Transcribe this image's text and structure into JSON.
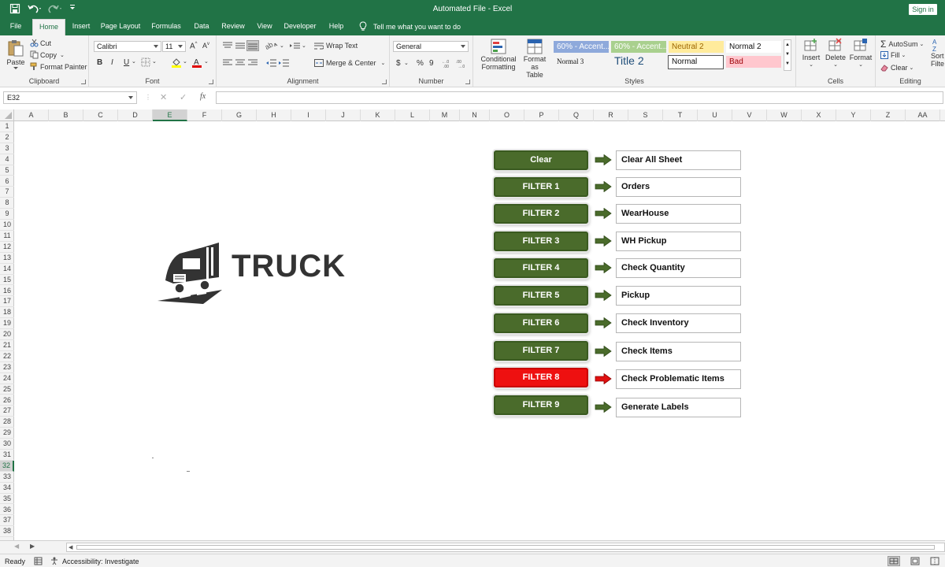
{
  "window": {
    "title": "Automated File  -  Excel",
    "sign_in": "Sign in"
  },
  "tabs": [
    {
      "label": "File"
    },
    {
      "label": "Home"
    },
    {
      "label": "Insert"
    },
    {
      "label": "Page Layout"
    },
    {
      "label": "Formulas"
    },
    {
      "label": "Data"
    },
    {
      "label": "Review"
    },
    {
      "label": "View"
    },
    {
      "label": "Developer"
    },
    {
      "label": "Help"
    }
  ],
  "tell_me": "Tell me what you want to do",
  "ribbon": {
    "clipboard": {
      "paste": "Paste",
      "cut": "Cut",
      "copy": "Copy",
      "format_painter": "Format Painter",
      "label": "Clipboard"
    },
    "font": {
      "name": "Calibri",
      "size": "11",
      "bold": "B",
      "italic": "I",
      "underline": "U",
      "label": "Font"
    },
    "alignment": {
      "wrap_text": "Wrap Text",
      "merge_center": "Merge & Center",
      "label": "Alignment"
    },
    "number": {
      "format": "General",
      "currency": "$",
      "percent": "%",
      "comma": "9",
      "label": "Number"
    },
    "styles": {
      "conditional_1": "Conditional",
      "conditional_2": "Formatting",
      "format_as_1": "Format as",
      "format_as_2": "Table",
      "cells": [
        {
          "label": "60% - Accent...",
          "color": "#8ea9db"
        },
        {
          "label": "60% - Accent...",
          "color": "#a9d08e"
        },
        {
          "label": "Neutral 2",
          "color": "#ffeb9c"
        },
        {
          "label": "Normal 2",
          "color": "#ffffff"
        },
        {
          "label": "Normal 3",
          "color": "#ffffff"
        },
        {
          "label": "Title 2",
          "color": "#ffffff"
        },
        {
          "label": "Normal",
          "color": "#ffffff"
        },
        {
          "label": "Bad",
          "color": "#ffc7ce"
        }
      ],
      "label": "Styles"
    },
    "cells": {
      "insert": "Insert",
      "delete": "Delete",
      "format": "Format",
      "label": "Cells"
    },
    "editing": {
      "autosum": "AutoSum",
      "fill": "Fill",
      "clear": "Clear",
      "sort_1": "Sort",
      "sort_2": "Filte",
      "label": "Editing"
    }
  },
  "formula_bar": {
    "name_box": "E32",
    "fx": "fx",
    "value": ""
  },
  "columns": [
    "A",
    "B",
    "C",
    "D",
    "E",
    "F",
    "G",
    "H",
    "I",
    "J",
    "K",
    "L",
    "M",
    "N",
    "O",
    "P",
    "Q",
    "R",
    "S",
    "T",
    "U",
    "V",
    "W",
    "X",
    "Y",
    "Z",
    "AA"
  ],
  "selected_column": "E",
  "rows": [
    "1",
    "2",
    "3",
    "4",
    "5",
    "6",
    "7",
    "8",
    "9",
    "10",
    "11",
    "12",
    "13",
    "14",
    "15",
    "16",
    "17",
    "18",
    "19",
    "20",
    "21",
    "22",
    "23",
    "24",
    "25",
    "26",
    "27",
    "28",
    "29",
    "30",
    "31",
    "32",
    "33",
    "34",
    "35",
    "36",
    "37",
    "38"
  ],
  "selected_row": "32",
  "logo": {
    "text": "TRUCK"
  },
  "filters": [
    {
      "button": "Clear",
      "description": "Clear All Sheet",
      "color": "#4a6b2b"
    },
    {
      "button": "FILTER 1",
      "description": "Orders",
      "color": "#4a6b2b"
    },
    {
      "button": "FILTER 2",
      "description": "WearHouse",
      "color": "#4a6b2b"
    },
    {
      "button": "FILTER 3",
      "description": "WH Pickup",
      "color": "#4a6b2b"
    },
    {
      "button": "FILTER 4",
      "description": "Check Quantity",
      "color": "#4a6b2b"
    },
    {
      "button": "FILTER 5",
      "description": "Pickup",
      "color": "#4a6b2b"
    },
    {
      "button": "FILTER 6",
      "description": "Check Inventory",
      "color": "#4a6b2b"
    },
    {
      "button": "FILTER 7",
      "description": "Check Items",
      "color": "#4a6b2b"
    },
    {
      "button": "FILTER 8",
      "description": "Check Problematic Items",
      "color": "#ee1010"
    },
    {
      "button": "FILTER 9",
      "description": "Generate Labels",
      "color": "#4a6b2b"
    }
  ],
  "status": {
    "ready": "Ready",
    "accessibility": "Accessibility: Investigate"
  }
}
